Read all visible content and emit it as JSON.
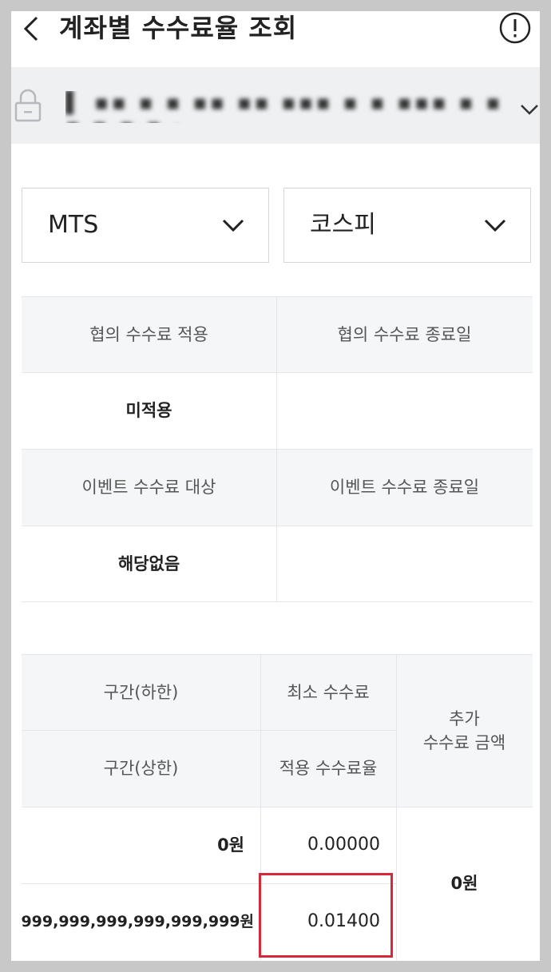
{
  "header": {
    "title": "계좌별 수수료율 조회"
  },
  "account": {
    "masked_text": "▌ ▪▪ ▪ ▪ ▪▪ ▪▪ ▪▪▪ ▪ ▪ ▪▪▪ ▪ ▪ ▪ ▪ ▪ ▪ ·"
  },
  "filters": {
    "channel": "MTS",
    "market": "코스피"
  },
  "agreement": {
    "col1_header": "협의 수수료 적용",
    "col2_header": "협의 수수료 종료일",
    "col1_value": "미적용",
    "col2_value": ""
  },
  "event": {
    "col1_header": "이벤트 수수료 대상",
    "col2_header": "이벤트 수수료 종료일",
    "col1_value": "해당없음",
    "col2_value": ""
  },
  "fee_table": {
    "header_range_low": "구간(하한)",
    "header_range_high": "구간(상한)",
    "header_min_fee": "최소 수수료",
    "header_rate": "적용 수수료율",
    "header_extra": "추가\n수수료 금액",
    "row_low": "0원",
    "row_high": "999,999,999,999,999,999원",
    "min_fee_value": "0.00000",
    "rate_value": "0.01400",
    "extra_value": "0원"
  },
  "colors": {
    "highlight": "#d62836",
    "account_bar": "#eef0f2",
    "header_cell": "#f4f6f8"
  }
}
